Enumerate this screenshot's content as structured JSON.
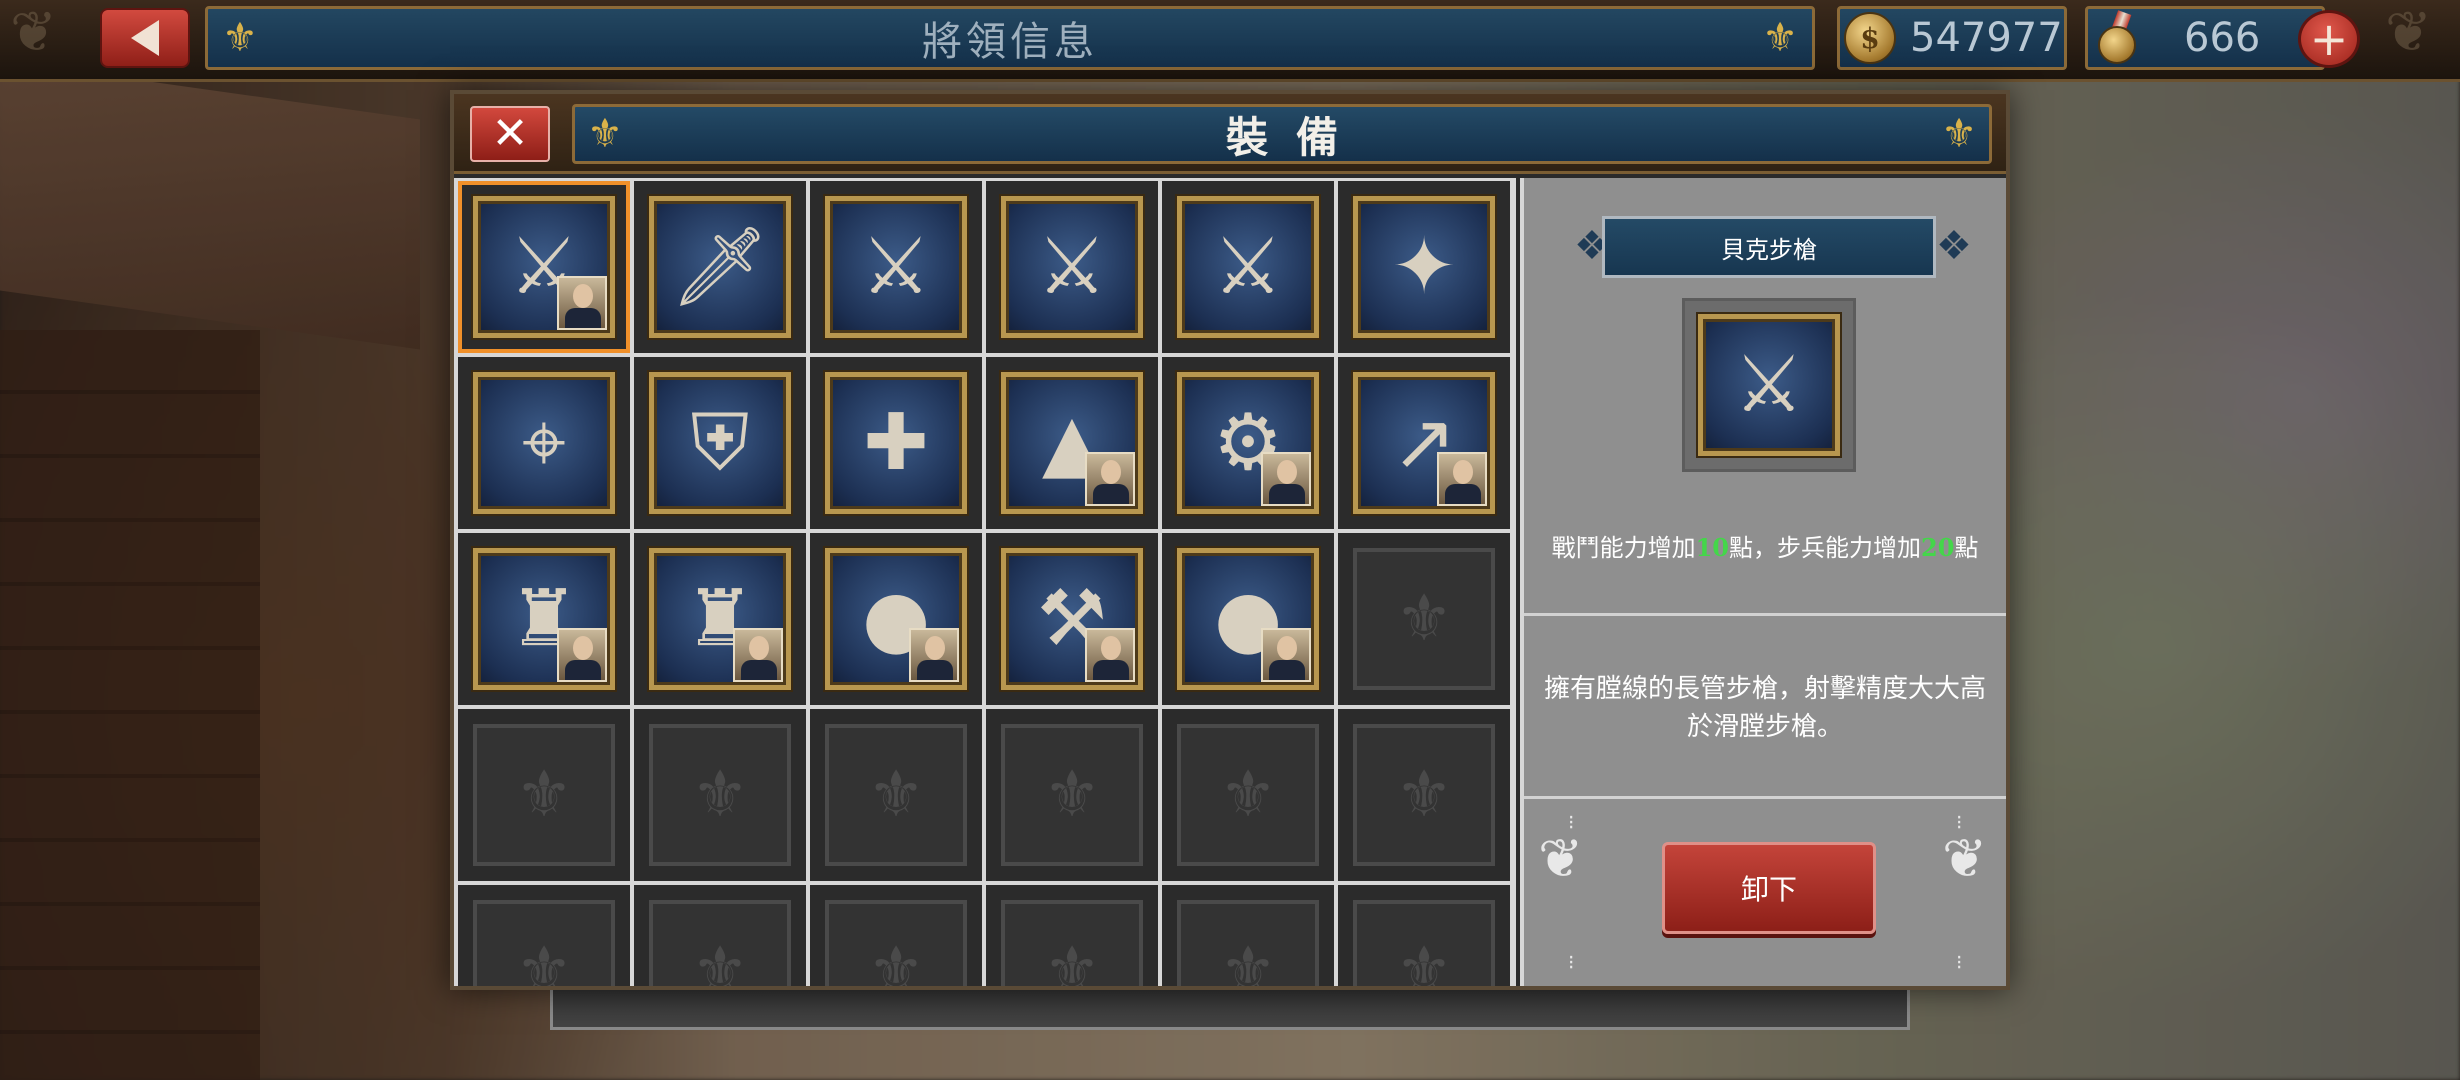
{
  "header": {
    "title": "將領信息",
    "gold": "547977",
    "medals": "666"
  },
  "dialog": {
    "title": "裝備"
  },
  "inventory": {
    "slots": [
      {
        "item": "musket",
        "glyph": "⚔",
        "portrait": true,
        "selected": true
      },
      {
        "item": "dagger",
        "glyph": "🗡",
        "portrait": false
      },
      {
        "item": "sabre",
        "glyph": "⚔",
        "portrait": false
      },
      {
        "item": "cavalry-sabre",
        "glyph": "⚔",
        "portrait": false
      },
      {
        "item": "cavalry-sabre-2",
        "glyph": "⚔",
        "portrait": false
      },
      {
        "item": "sextant",
        "glyph": "✦",
        "portrait": false
      },
      {
        "item": "telescope",
        "glyph": "⌖",
        "portrait": false
      },
      {
        "item": "cuirass",
        "glyph": "⛨",
        "portrait": false
      },
      {
        "item": "medical-cart",
        "glyph": "✚",
        "portrait": false
      },
      {
        "item": "gunpowder",
        "glyph": "▲",
        "portrait": true
      },
      {
        "item": "pistol",
        "glyph": "⚙",
        "portrait": true
      },
      {
        "item": "spear",
        "glyph": "↗",
        "portrait": true
      },
      {
        "item": "uniform",
        "glyph": "♜",
        "portrait": true
      },
      {
        "item": "uniform-2",
        "glyph": "♜",
        "portrait": true
      },
      {
        "item": "cannonballs",
        "glyph": "●",
        "portrait": true
      },
      {
        "item": "cannon",
        "glyph": "⚒",
        "portrait": true
      },
      {
        "item": "cannonballs-2",
        "glyph": "●",
        "portrait": true
      },
      {
        "item": "empty"
      },
      {
        "item": "empty"
      },
      {
        "item": "empty"
      },
      {
        "item": "empty"
      },
      {
        "item": "empty"
      },
      {
        "item": "empty"
      },
      {
        "item": "empty"
      },
      {
        "item": "empty"
      },
      {
        "item": "empty"
      },
      {
        "item": "empty"
      },
      {
        "item": "empty"
      },
      {
        "item": "empty"
      },
      {
        "item": "empty"
      }
    ]
  },
  "detail": {
    "name": "貝克步槍",
    "effect_prefix": "戰鬥能力增加",
    "effect_value1": "10",
    "effect_mid": "點，步兵能力增加",
    "effect_value2": "20",
    "effect_suffix": "點",
    "description": "擁有膛線的長管步槍，射擊精度大大高於滑膛步槍。",
    "unequip_label": "卸下"
  },
  "colors": {
    "accent_gold": "#b8974f",
    "selected_outline": "#f0902a",
    "button_red": "#c4443a",
    "effect_number": "#44d64a"
  }
}
